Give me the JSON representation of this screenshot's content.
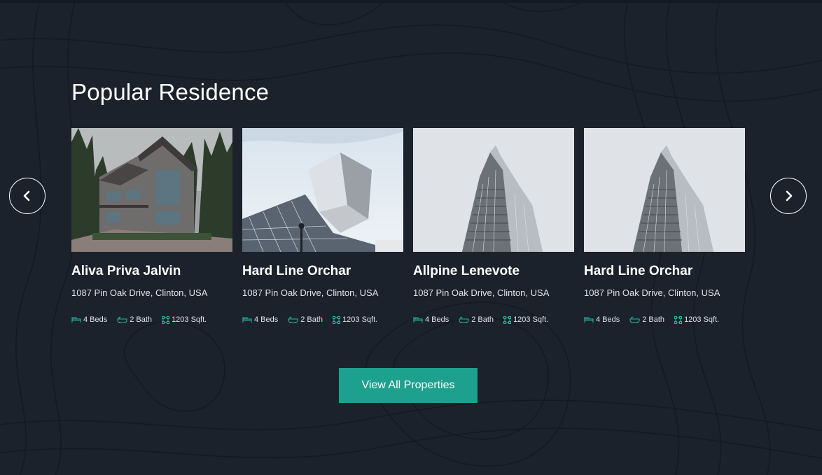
{
  "section": {
    "title": "Popular Residence"
  },
  "carousel": {
    "prev_icon": "chevron-left-icon",
    "next_icon": "chevron-right-icon"
  },
  "properties": [
    {
      "name": "Aliva Priva Jalvin",
      "address": "1087 Pin Oak Drive, Clinton, USA",
      "beds": "4 Beds",
      "bath": "2 Bath",
      "area": "1203 Sqft.",
      "image": "modern-house-photo"
    },
    {
      "name": "Hard Line Orchar",
      "address": "1087 Pin Oak Drive, Clinton, USA",
      "beds": "4 Beds",
      "bath": "2 Bath",
      "area": "1203 Sqft.",
      "image": "angular-glass-building-photo"
    },
    {
      "name": "Allpine Lenevote",
      "address": "1087 Pin Oak Drive, Clinton, USA",
      "beds": "4 Beds",
      "bath": "2 Bath",
      "area": "1203 Sqft.",
      "image": "skyscraper-photo"
    },
    {
      "name": "Hard Line Orchar",
      "address": "1087 Pin Oak Drive, Clinton, USA",
      "beds": "4 Beds",
      "bath": "2 Bath",
      "area": "1203 Sqft.",
      "image": "skyscraper-photo"
    }
  ],
  "cta": {
    "label": "View All Properties"
  },
  "colors": {
    "background": "#1b222c",
    "accent": "#1ea08e",
    "icon": "#23b5a0",
    "text": "#ffffff"
  }
}
